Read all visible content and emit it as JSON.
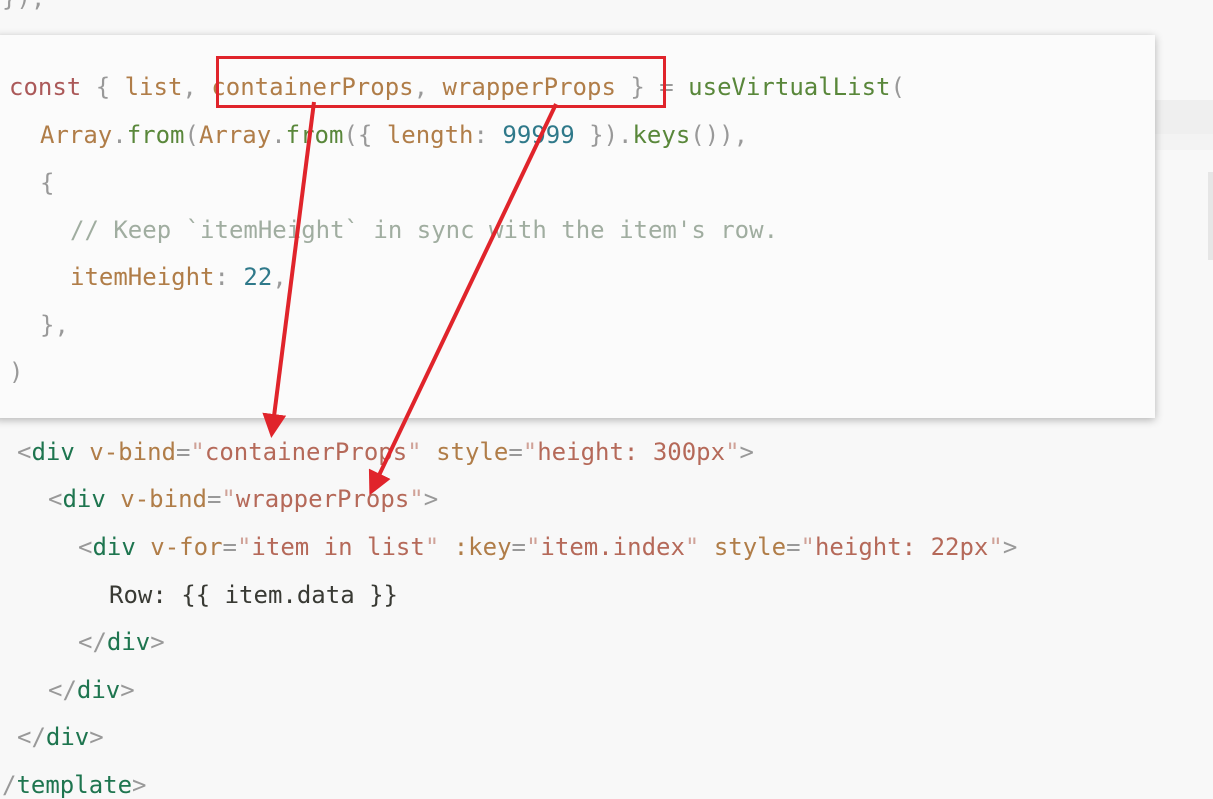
{
  "background_code": {
    "top_fragment": "});",
    "lines": [
      {
        "tokens": [
          {
            "t": "<",
            "c": "punc"
          },
          {
            "t": "div",
            "c": "tag"
          },
          {
            "t": " ",
            "c": "plain"
          },
          {
            "t": "v-bind",
            "c": "attr"
          },
          {
            "t": "=",
            "c": "punc"
          },
          {
            "t": "\"",
            "c": "quote"
          },
          {
            "t": "containerProps",
            "c": "string"
          },
          {
            "t": "\"",
            "c": "quote"
          },
          {
            "t": " ",
            "c": "plain"
          },
          {
            "t": "style",
            "c": "attr"
          },
          {
            "t": "=",
            "c": "punc"
          },
          {
            "t": "\"",
            "c": "quote"
          },
          {
            "t": "height: 300px",
            "c": "string"
          },
          {
            "t": "\"",
            "c": "quote"
          },
          {
            "t": ">",
            "c": "punc"
          }
        ]
      },
      {
        "tokens": [
          {
            "t": "<",
            "c": "punc"
          },
          {
            "t": "div",
            "c": "tag"
          },
          {
            "t": " ",
            "c": "plain"
          },
          {
            "t": "v-bind",
            "c": "attr"
          },
          {
            "t": "=",
            "c": "punc"
          },
          {
            "t": "\"",
            "c": "quote"
          },
          {
            "t": "wrapperProps",
            "c": "string"
          },
          {
            "t": "\"",
            "c": "quote"
          },
          {
            "t": ">",
            "c": "punc"
          }
        ]
      },
      {
        "tokens": [
          {
            "t": "<",
            "c": "punc"
          },
          {
            "t": "div",
            "c": "tag"
          },
          {
            "t": " ",
            "c": "plain"
          },
          {
            "t": "v-for",
            "c": "attr"
          },
          {
            "t": "=",
            "c": "punc"
          },
          {
            "t": "\"",
            "c": "quote"
          },
          {
            "t": "item in list",
            "c": "string"
          },
          {
            "t": "\"",
            "c": "quote"
          },
          {
            "t": " ",
            "c": "plain"
          },
          {
            "t": ":key",
            "c": "attr"
          },
          {
            "t": "=",
            "c": "punc"
          },
          {
            "t": "\"",
            "c": "quote"
          },
          {
            "t": "item.index",
            "c": "string"
          },
          {
            "t": "\"",
            "c": "quote"
          },
          {
            "t": " ",
            "c": "plain"
          },
          {
            "t": "style",
            "c": "attr"
          },
          {
            "t": "=",
            "c": "punc"
          },
          {
            "t": "\"",
            "c": "quote"
          },
          {
            "t": "height: 22px",
            "c": "string"
          },
          {
            "t": "\"",
            "c": "quote"
          },
          {
            "t": ">",
            "c": "punc"
          }
        ]
      },
      {
        "tokens": [
          {
            "t": "Row: {{ item.data }}",
            "c": "plain"
          }
        ]
      },
      {
        "tokens": [
          {
            "t": "</",
            "c": "punc"
          },
          {
            "t": "div",
            "c": "tag"
          },
          {
            "t": ">",
            "c": "punc"
          }
        ]
      },
      {
        "tokens": [
          {
            "t": "</",
            "c": "punc"
          },
          {
            "t": "div",
            "c": "tag"
          },
          {
            "t": ">",
            "c": "punc"
          }
        ]
      },
      {
        "tokens": [
          {
            "t": "</",
            "c": "punc"
          },
          {
            "t": "div",
            "c": "tag"
          },
          {
            "t": ">",
            "c": "punc"
          }
        ]
      },
      {
        "tokens": [
          {
            "t": "/",
            "c": "punc"
          },
          {
            "t": "template",
            "c": "tag"
          },
          {
            "t": ">",
            "c": "punc"
          }
        ]
      }
    ]
  },
  "popup_code": {
    "lines": [
      {
        "tokens": [
          {
            "t": "const",
            "c": "keyword"
          },
          {
            "t": " ",
            "c": "plain"
          },
          {
            "t": "{",
            "c": "punc"
          },
          {
            "t": " ",
            "c": "plain"
          },
          {
            "t": "list",
            "c": "var"
          },
          {
            "t": ",",
            "c": "punc"
          },
          {
            "t": " ",
            "c": "plain"
          },
          {
            "t": "containerProps",
            "c": "var"
          },
          {
            "t": ",",
            "c": "punc"
          },
          {
            "t": " ",
            "c": "plain"
          },
          {
            "t": "wrapperProps",
            "c": "var"
          },
          {
            "t": " ",
            "c": "plain"
          },
          {
            "t": "}",
            "c": "punc"
          },
          {
            "t": " ",
            "c": "plain"
          },
          {
            "t": "=",
            "c": "punc"
          },
          {
            "t": " ",
            "c": "plain"
          },
          {
            "t": "useVirtualList",
            "c": "fn"
          },
          {
            "t": "(",
            "c": "punc"
          }
        ]
      },
      {
        "tokens": [
          {
            "t": "Array",
            "c": "var"
          },
          {
            "t": ".",
            "c": "punc"
          },
          {
            "t": "from",
            "c": "fn"
          },
          {
            "t": "(",
            "c": "punc"
          },
          {
            "t": "Array",
            "c": "var"
          },
          {
            "t": ".",
            "c": "punc"
          },
          {
            "t": "from",
            "c": "fn"
          },
          {
            "t": "({",
            "c": "punc"
          },
          {
            "t": " ",
            "c": "plain"
          },
          {
            "t": "length",
            "c": "var"
          },
          {
            "t": ":",
            "c": "punc"
          },
          {
            "t": " ",
            "c": "plain"
          },
          {
            "t": "99999",
            "c": "num"
          },
          {
            "t": " ",
            "c": "plain"
          },
          {
            "t": "}).",
            "c": "punc"
          },
          {
            "t": "keys",
            "c": "fn"
          },
          {
            "t": "()),",
            "c": "punc"
          }
        ]
      },
      {
        "tokens": [
          {
            "t": "{",
            "c": "punc"
          }
        ]
      },
      {
        "tokens": [
          {
            "t": "// Keep `itemHeight` in sync with the item's row.",
            "c": "comment"
          }
        ]
      },
      {
        "tokens": [
          {
            "t": "itemHeight",
            "c": "var"
          },
          {
            "t": ":",
            "c": "punc"
          },
          {
            "t": " ",
            "c": "plain"
          },
          {
            "t": "22",
            "c": "num"
          },
          {
            "t": ",",
            "c": "punc"
          }
        ]
      },
      {
        "tokens": [
          {
            "t": "},",
            "c": "punc"
          }
        ]
      },
      {
        "tokens": [
          {
            "t": ")",
            "c": "punc"
          }
        ]
      }
    ]
  },
  "annotation": {
    "box_color": "#e0242b",
    "arrow_color": "#e0242b"
  }
}
